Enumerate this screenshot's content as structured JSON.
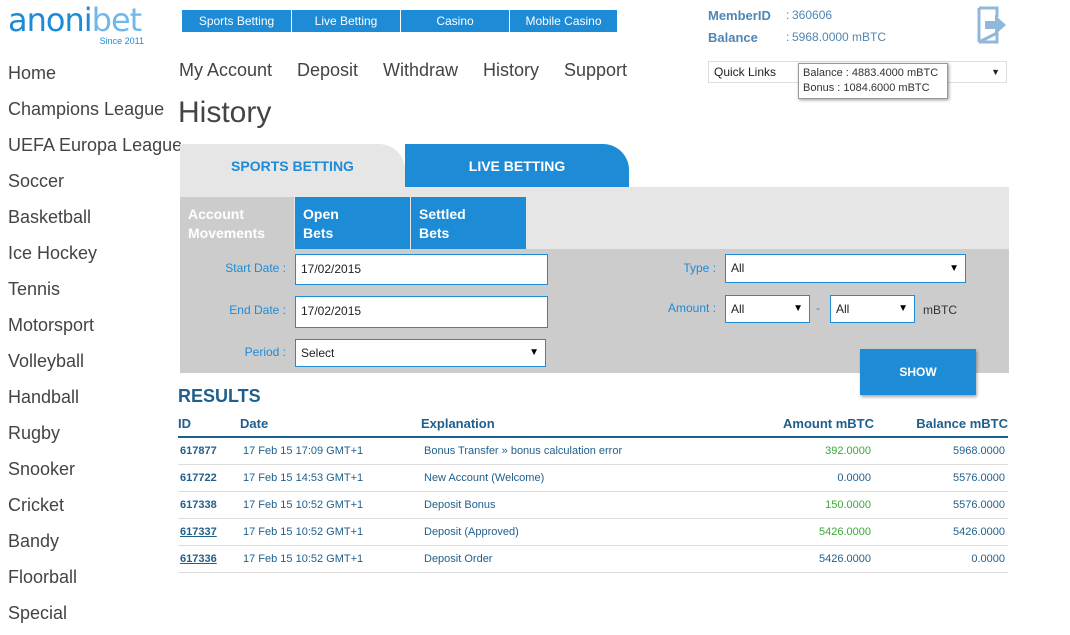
{
  "brand": {
    "name_part1": "anoni",
    "name_part2": "bet",
    "since": "Since 2011"
  },
  "top_nav": [
    "Sports Betting",
    "Live Betting",
    "Casino",
    "Mobile Casino"
  ],
  "member": {
    "id_label": "MemberID",
    "id_sep": ":",
    "id_value": "360606",
    "balance_label": "Balance",
    "balance_value": "5968.0000 mBTC"
  },
  "sidebar": [
    "Home",
    "Champions League",
    "UEFA Europa League",
    "Soccer",
    "Basketball",
    "Ice Hockey",
    "Tennis",
    "Motorsport",
    "Volleyball",
    "Handball",
    "Rugby",
    "Snooker",
    "Cricket",
    "Bandy",
    "Floorball",
    "Special"
  ],
  "account_menu": [
    "My Account",
    "Deposit",
    "Withdraw",
    "History",
    "Support"
  ],
  "quick_links": {
    "label": "Quick Links",
    "caret": "▼"
  },
  "tooltip": {
    "balance": "Balance : 4883.4000 mBTC",
    "bonus": "Bonus : 1084.6000 mBTC"
  },
  "page_title": "History",
  "tabs": {
    "sports": "SPORTS BETTING",
    "live": "LIVE BETTING"
  },
  "subtabs": {
    "account_l1": "Account",
    "account_l2": "Movements",
    "open_l1": "Open",
    "open_l2": "Bets",
    "settled_l1": "Settled",
    "settled_l2": "Bets"
  },
  "filters": {
    "start_label": "Start Date :",
    "start_value": "17/02/2015",
    "end_label": "End Date :",
    "end_value": "17/02/2015",
    "period_label": "Period :",
    "period_value": "Select",
    "type_label": "Type :",
    "type_value": "All",
    "amount_label": "Amount :",
    "amount_from": "All",
    "amount_dash": "-",
    "amount_to": "All",
    "amount_unit": "mBTC"
  },
  "show_button": "SHOW",
  "results": {
    "title": "RESULTS",
    "headers": {
      "id": "ID",
      "date": "Date",
      "explanation": "Explanation",
      "amount": "Amount mBTC",
      "balance": "Balance mBTC"
    },
    "rows": [
      {
        "id": "617877",
        "date": "17 Feb 15 17:09 GMT+1",
        "explanation": "Bonus Transfer » bonus calculation error",
        "amount": "392.0000",
        "balance": "5968.0000"
      },
      {
        "id": "617722",
        "date": "17 Feb 15 14:53 GMT+1",
        "explanation": "New Account (Welcome)",
        "amount": "0.0000",
        "balance": "5576.0000"
      },
      {
        "id": "617338",
        "date": "17 Feb 15 10:52 GMT+1",
        "explanation": "Deposit Bonus",
        "amount": "150.0000",
        "balance": "5576.0000"
      },
      {
        "id": "617337",
        "date": "17 Feb 15 10:52 GMT+1",
        "explanation": "Deposit (Approved)",
        "amount": "5426.0000",
        "balance": "5426.0000"
      },
      {
        "id": "617336",
        "date": "17 Feb 15 10:52 GMT+1",
        "explanation": "Deposit Order",
        "amount": "5426.0000",
        "balance": "0.0000"
      }
    ]
  },
  "colors": {
    "accent": "#1e8bd6",
    "dark_blue": "#1f5f8b",
    "positive": "#3aaa35",
    "neutral": "#1f5f8b",
    "panel_gray": "#cccccc"
  },
  "icons": {
    "logout": "logout-arrow-icon",
    "caret": "chevron-down-icon"
  }
}
